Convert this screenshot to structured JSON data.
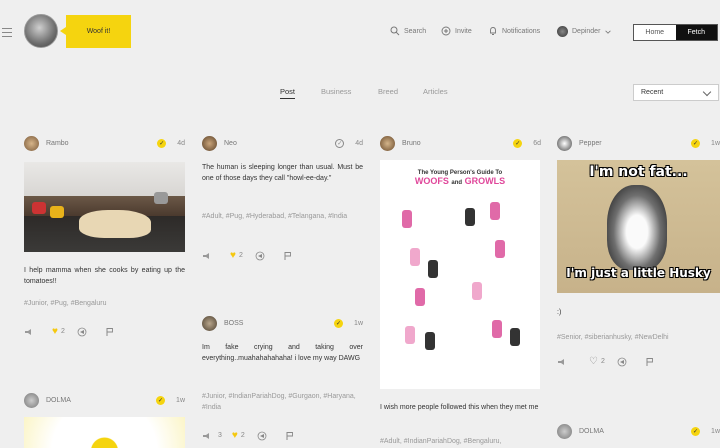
{
  "header": {
    "bubble": "Woof it!",
    "nav": {
      "search": "Search",
      "invite": "Invite",
      "notifications": "Notifications",
      "user": "Depinder"
    },
    "toggle": {
      "home": "Home",
      "fetch": "Fetch"
    }
  },
  "tabs": [
    "Post",
    "Business",
    "Breed",
    "Articles"
  ],
  "sort": {
    "selected": "Recent"
  },
  "posts": {
    "rambo": {
      "name": "Rambo",
      "time": "4d",
      "text": "I help mamma when she cooks by eating up the tomatoes!!",
      "tags": "#Junior, #Pug, #Bengaluru",
      "likes": "2"
    },
    "neo": {
      "name": "Neo",
      "time": "4d",
      "text": "The human is sleeping longer than usual. Must be one of those days they call \"howl-ee-day.\"",
      "tags": "#Adult, #Pug, #Hyderabad, #Telangana, #India",
      "likes": "2"
    },
    "boss": {
      "name": "BOSS",
      "time": "1w",
      "text": "Im fake crying and taking over everything..muahahahahaha! i love my way DAWG",
      "tags": "#Junior, #IndianPariahDog, #Gurgaon, #Haryana, #India",
      "barks": "3",
      "likes": "2"
    },
    "bruno": {
      "name": "Bruno",
      "time": "6d",
      "image_title": "The Young Person's Guide To",
      "image_heading_a": "WOOFS",
      "image_heading_and": "and",
      "image_heading_b": "GROWLS",
      "text": "I wish more people followed this when they met me",
      "tags": "#Adult, #IndianPariahDog, #Bengaluru,"
    },
    "pepper": {
      "name": "Pepper",
      "time": "1w",
      "meme_top": "I'm not fat...",
      "meme_bottom": "I'm just a little Husky",
      "text": ":)",
      "tags": "#Senior, #siberianhusky, #NewDelhi",
      "likes": "2"
    },
    "dolma1": {
      "name": "DOLMA",
      "time": "1w"
    },
    "dolma2": {
      "name": "DOLMA",
      "time": "1w"
    }
  },
  "colors": {
    "accent": "#f5d40f",
    "background": "#efefef",
    "active_toggle": "#111111"
  }
}
